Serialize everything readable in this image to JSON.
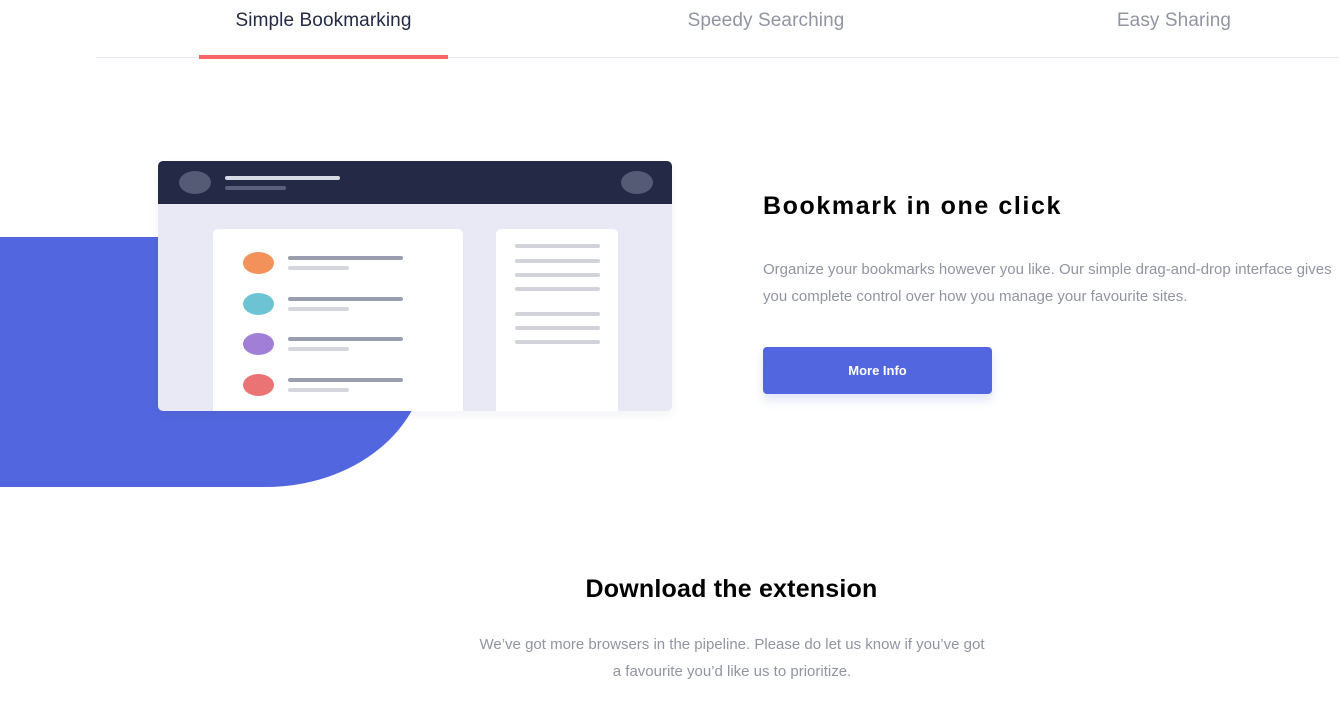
{
  "tabs": [
    {
      "label": "Simple Bookmarking",
      "active": true
    },
    {
      "label": "Speedy Searching",
      "active": false
    },
    {
      "label": "Easy Sharing",
      "active": false
    }
  ],
  "feature": {
    "title": "Bookmark in one click",
    "description": "Organize your bookmarks however you like. Our simple drag-and-drop interface gives you complete control over how you manage your favourite sites.",
    "button_label": "More Info"
  },
  "illustration": {
    "dot_colors": [
      "#f2915a",
      "#6cc4d3",
      "#a27fd6",
      "#ea7373"
    ]
  },
  "download": {
    "title": "Download the extension",
    "description": "We’ve got more browsers in the pipeline. Please do let us know if you’ve got a favourite you’d like us to prioritize."
  },
  "colors": {
    "accent_red": "#fa5757",
    "accent_blue": "#5267df",
    "dark_navy": "#242a45",
    "muted_text": "#9194a1"
  }
}
